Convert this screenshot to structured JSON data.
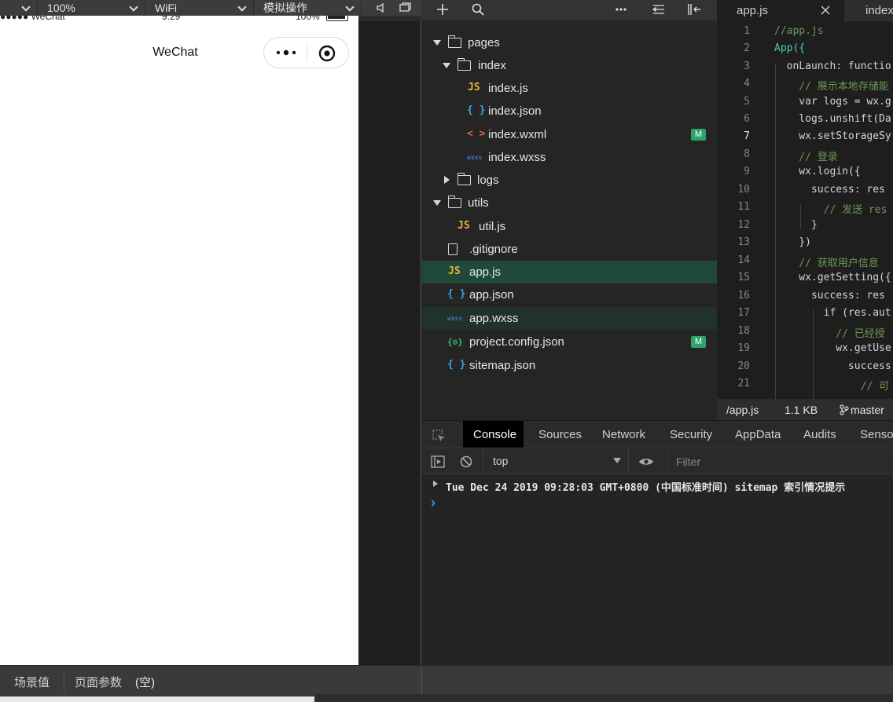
{
  "toolbar": {
    "zoom": "100%",
    "network": "WiFi",
    "simulate": "模拟操作"
  },
  "tabs": [
    {
      "label": "app.js"
    },
    {
      "label": "index"
    }
  ],
  "phone": {
    "status_left": "●●●●● WeChat",
    "status_time": "9:29",
    "status_battery": "100%",
    "nav_title": "WeChat"
  },
  "tree": {
    "items": [
      {
        "label": "pages"
      },
      {
        "label": "index"
      },
      {
        "label": "index.js",
        "icon": "JS"
      },
      {
        "label": "index.json",
        "icon": "{ }"
      },
      {
        "label": "index.wxml",
        "icon": "< >",
        "badge": "M"
      },
      {
        "label": "index.wxss",
        "icon": "wxss"
      },
      {
        "label": "logs"
      },
      {
        "label": "utils"
      },
      {
        "label": "util.js",
        "icon": "JS"
      },
      {
        "label": ".gitignore"
      },
      {
        "label": "app.js",
        "icon": "JS"
      },
      {
        "label": "app.json",
        "icon": "{ }"
      },
      {
        "label": "app.wxss",
        "icon": "wxss"
      },
      {
        "label": "project.config.json",
        "icon": "{⚙}",
        "badge": "M"
      },
      {
        "label": "sitemap.json",
        "icon": "{ }"
      }
    ]
  },
  "editor": {
    "line_numbers": [
      "1",
      "2",
      "3",
      "4",
      "5",
      "6",
      "7",
      "8",
      "9",
      "10",
      "11",
      "12",
      "13",
      "14",
      "15",
      "16",
      "17",
      "18",
      "19",
      "20",
      "21"
    ],
    "current_line": "7",
    "lines": [
      "//app.js",
      "App({",
      "  onLaunch: functio",
      "    // 展示本地存储能",
      "    var logs = wx.g",
      "    logs.unshift(Da",
      "    wx.setStorageSy",
      "    // 登录",
      "    wx.login({",
      "      success: res",
      "        // 发送 res",
      "      }",
      "    })",
      "    // 获取用户信息",
      "    wx.getSetting({",
      "      success: res",
      "        if (res.aut",
      "          // 已经授",
      "          wx.getUse",
      "            success",
      "              // 可"
    ],
    "status": {
      "path": "/app.js",
      "size": "1.1 KB",
      "branch": "master"
    }
  },
  "devtools": {
    "tabs": [
      "Console",
      "Sources",
      "Network",
      "Security",
      "AppData",
      "Audits",
      "Sensor"
    ],
    "context": "top",
    "filter_placeholder": "Filter",
    "log": "Tue Dec 24 2019 09:28:03 GMT+0800 (中国标准时间) sitemap 索引情况提示",
    "prompt": "›"
  },
  "bottom": {
    "scene_label": "场景值",
    "params_label": "页面参数",
    "params_value": "(空)"
  },
  "colors": {
    "selected_row": "#1f4a39",
    "badge": "#2fa36b",
    "js_icon": "#e8b536",
    "json_icon": "#35a9e6"
  }
}
